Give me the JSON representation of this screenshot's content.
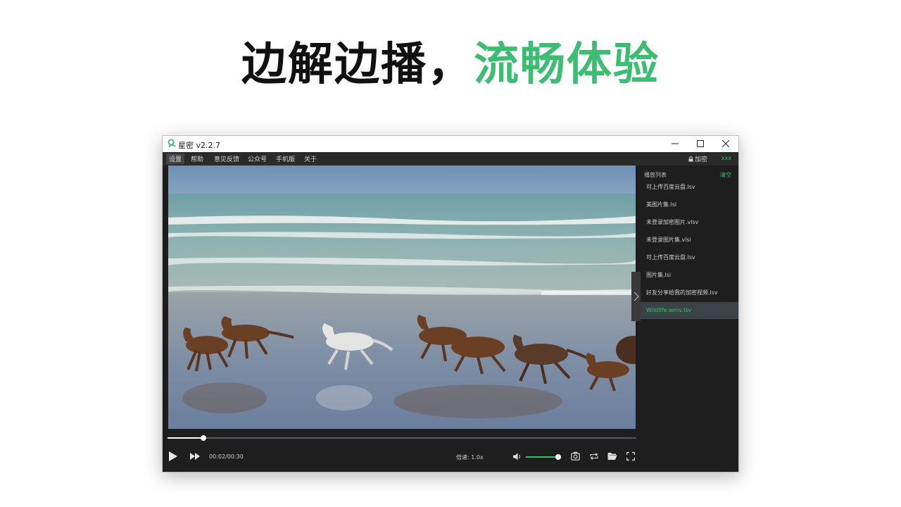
{
  "headline": {
    "part1": "边解边播，",
    "part2": "流畅体验"
  },
  "colors": {
    "accent": "#3dbd72",
    "dark_bg": "#1e1e1e",
    "menubar_bg": "#2a2a2a"
  },
  "window": {
    "title": "星密 v2.2.7",
    "logo_icon": "brand-logo-icon",
    "buttons": [
      "minimize-icon",
      "maximize-icon",
      "close-icon"
    ]
  },
  "menu": {
    "items": [
      "设置",
      "帮助",
      "意见反馈",
      "公众号",
      "手机版",
      "关于"
    ],
    "lock_label": "加密",
    "user": "xxx"
  },
  "playlist": {
    "header": "播放列表",
    "clear": "清空",
    "items": [
      "可上传百度云盘.lsv",
      "美图片集.lsi",
      "未登录加密图片.vlsv",
      "未登录图片集.vlsi",
      "可上传百度云盘.lsv",
      "图片集.lsi",
      "好友分享给我的加密视频.lsv",
      "Wildlife.wmv.lsv"
    ],
    "active_index": 7
  },
  "player": {
    "time": "00:02/00:30",
    "progress": 0.076,
    "speed": "倍速: 1.0x",
    "volume": 0.95,
    "icons": [
      "play-icon",
      "fast-forward-icon",
      "volume-icon",
      "screenshot-icon",
      "loop-icon",
      "open-folder-icon",
      "fullscreen-icon"
    ]
  }
}
